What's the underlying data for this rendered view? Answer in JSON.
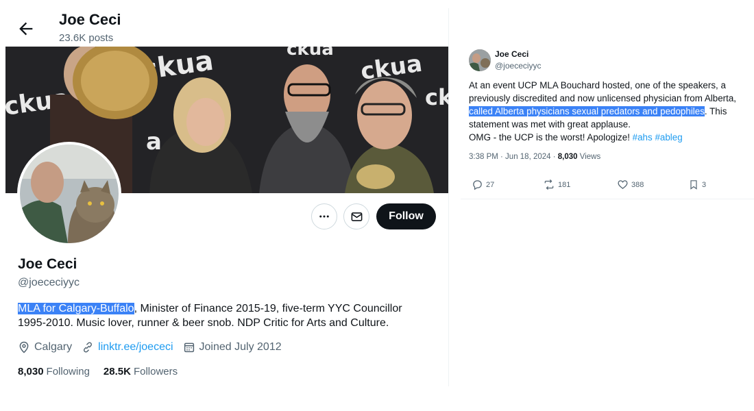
{
  "profile": {
    "header": {
      "name": "Joe Ceci",
      "posts": "23.6K posts"
    },
    "banner_words": [
      "ckua",
      "ckua",
      "ckua",
      "ckua",
      "a",
      "ck"
    ],
    "follow_label": "Follow",
    "name": "Joe Ceci",
    "handle": "@joececiyyc",
    "bio": {
      "highlighted": "MLA for Calgary-Buffalo",
      "rest": ", Minister of Finance 2015-19, five-term YYC Councillor 1995-2010. Music lover, runner & beer snob. NDP Critic for Arts and Culture."
    },
    "location": "Calgary",
    "link": "linktr.ee/joececi",
    "joined": "Joined July 2012",
    "following_count": "8,030",
    "following_label": "Following",
    "followers_count": "28.5K",
    "followers_label": "Followers"
  },
  "tweet": {
    "author_name": "Joe Ceci",
    "author_handle": "@joececiyyc",
    "text_part1": "At an event UCP MLA Bouchard hosted, one of the speakers, a previously discredited and now unlicensed physician from Alberta, ",
    "text_highlight": "called Alberta physicians sexual predators and pedophiles",
    "text_part2": ". This statement was met with great applause.",
    "text_line2": "OMG - the UCP is the worst! Apologize! ",
    "hashtag1": "#ahs",
    "hashtag2": "#ableg",
    "time": "3:38 PM · Jun 18, 2024 · ",
    "views_count": "8,030",
    "views_label": " Views",
    "replies": "27",
    "reposts": "181",
    "likes": "388",
    "bookmarks": "3"
  },
  "colors": {
    "accent": "#1d9bf0",
    "highlight": "#3b82f6",
    "text": "#0f1419",
    "muted": "#536471"
  }
}
